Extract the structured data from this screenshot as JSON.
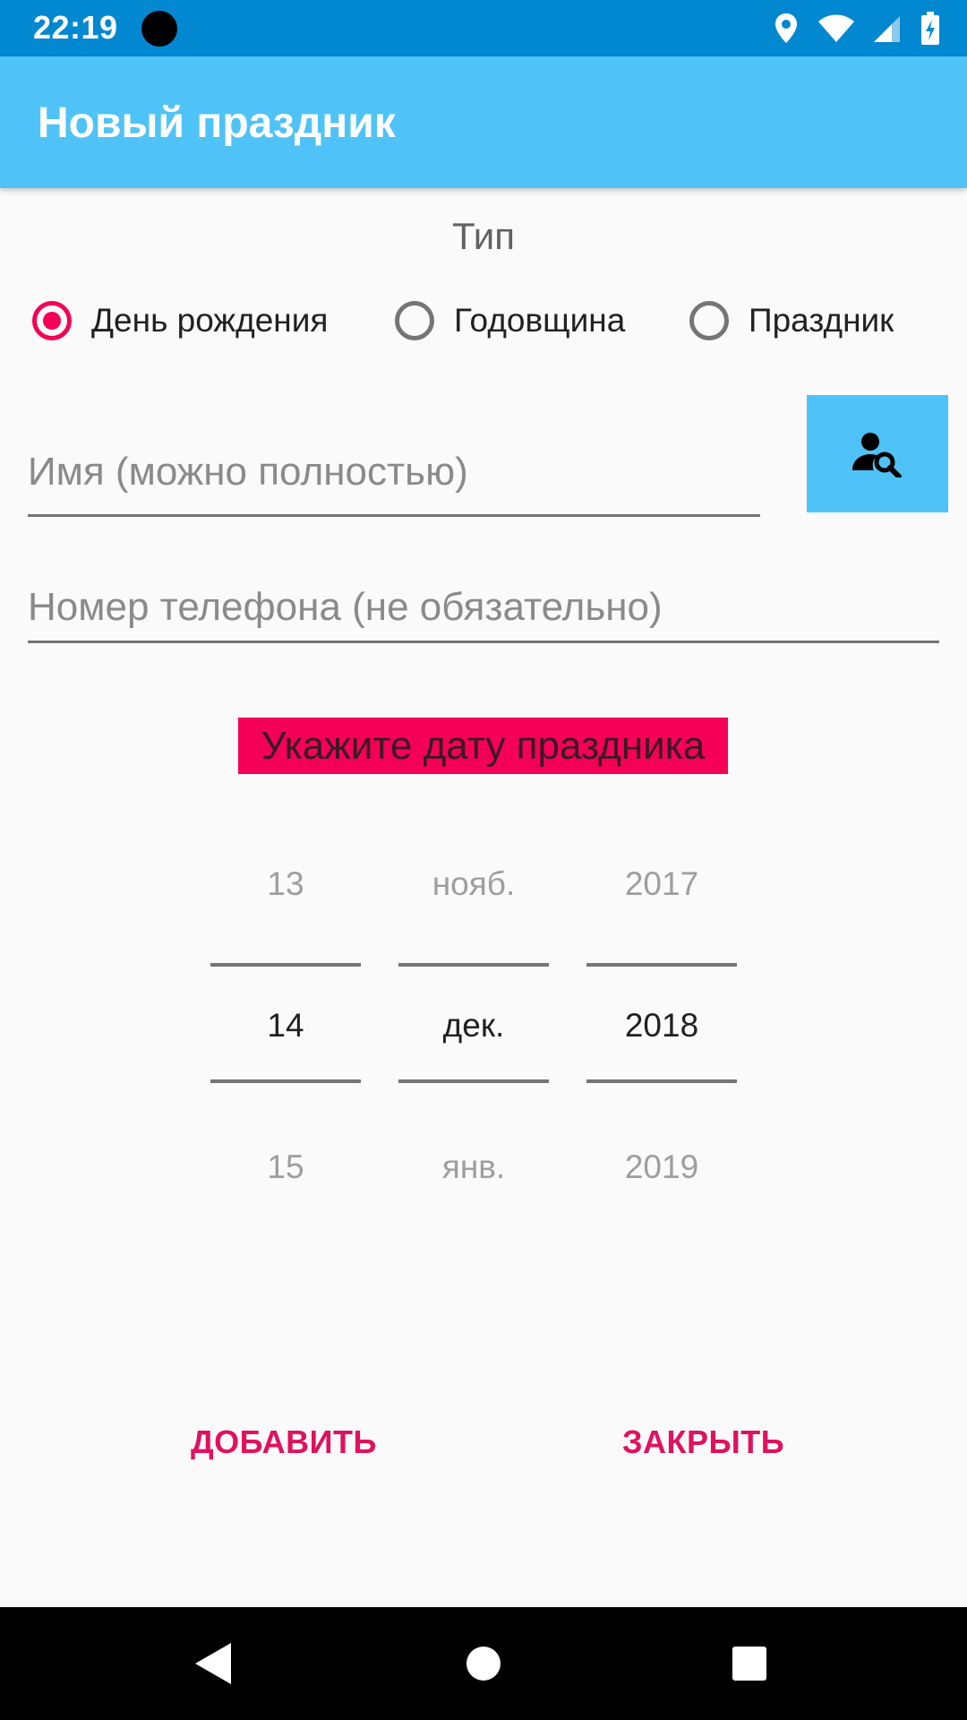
{
  "status_bar": {
    "time": "22:19",
    "icons": [
      "location-icon",
      "wifi-icon",
      "signal-icon",
      "battery-charging-icon"
    ]
  },
  "app_bar": {
    "title": "Новый праздник"
  },
  "type_section": {
    "label": "Тип",
    "options": [
      {
        "label": "День рождения",
        "checked": true
      },
      {
        "label": "Годовщина",
        "checked": false
      },
      {
        "label": "Праздник",
        "checked": false
      }
    ]
  },
  "name_field": {
    "value": "",
    "placeholder": "Имя (можно полностью)"
  },
  "contact_button": {
    "icon": "person-search-icon"
  },
  "phone_field": {
    "value": "",
    "placeholder": "Номер телефона (не обязательно)"
  },
  "date_prompt": "Укажите дату праздника",
  "date_picker": {
    "day": {
      "prev": "13",
      "current": "14",
      "next": "15"
    },
    "month": {
      "prev": "нояб.",
      "current": "дек.",
      "next": "янв."
    },
    "year": {
      "prev": "2017",
      "current": "2018",
      "next": "2019"
    }
  },
  "actions": {
    "add": "ДОБАВИТЬ",
    "close": "ЗАКРЫТЬ"
  },
  "colors": {
    "status_bar": "#0288d1",
    "app_bar": "#4fc3f7",
    "accent": "#f50057"
  }
}
